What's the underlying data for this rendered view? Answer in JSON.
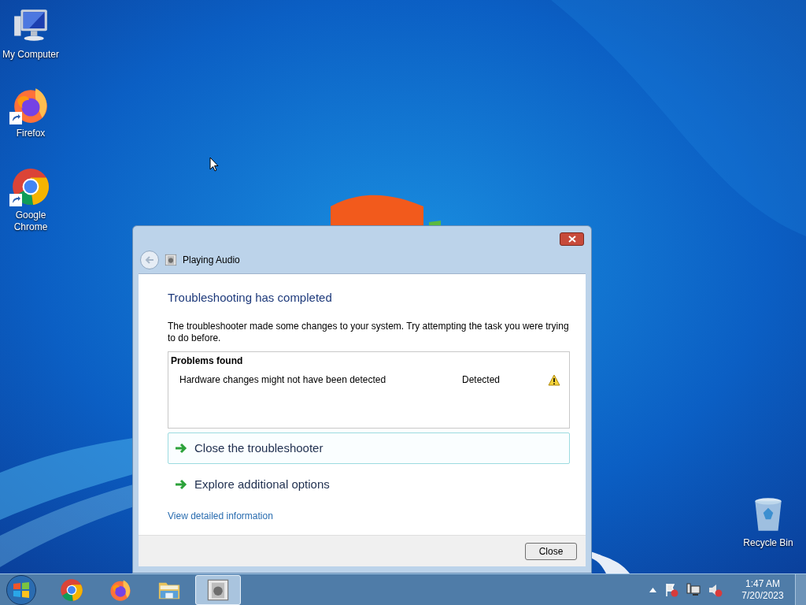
{
  "desktop_icons": [
    {
      "kind": "computer",
      "label": "My Computer",
      "shortcut": false
    },
    {
      "kind": "firefox",
      "label": "Firefox",
      "shortcut": true
    },
    {
      "kind": "chrome",
      "label": "Google Chrome",
      "shortcut": true
    },
    {
      "kind": "recycle",
      "label": "Recycle Bin",
      "shortcut": false
    }
  ],
  "dialog": {
    "title": "Playing Audio",
    "heading": "Troubleshooting has completed",
    "message": "The troubleshooter made some changes to your system. Try attempting the task you were trying to do before.",
    "problems": {
      "title": "Problems found",
      "items": [
        {
          "name": "Hardware changes might not have been detected",
          "status": "Detected"
        }
      ]
    },
    "options": [
      {
        "label": "Close the troubleshooter",
        "selected": true
      },
      {
        "label": "Explore additional options",
        "selected": false
      }
    ],
    "link": "View detailed information",
    "button": "Close"
  },
  "taskbar": {
    "items": [
      {
        "kind": "chrome",
        "selected": false
      },
      {
        "kind": "firefox",
        "selected": false
      },
      {
        "kind": "explorer",
        "selected": false
      },
      {
        "kind": "troubleshooter",
        "selected": true
      }
    ],
    "clock": {
      "time": "1:47 AM",
      "date": "7/20/2023"
    }
  }
}
